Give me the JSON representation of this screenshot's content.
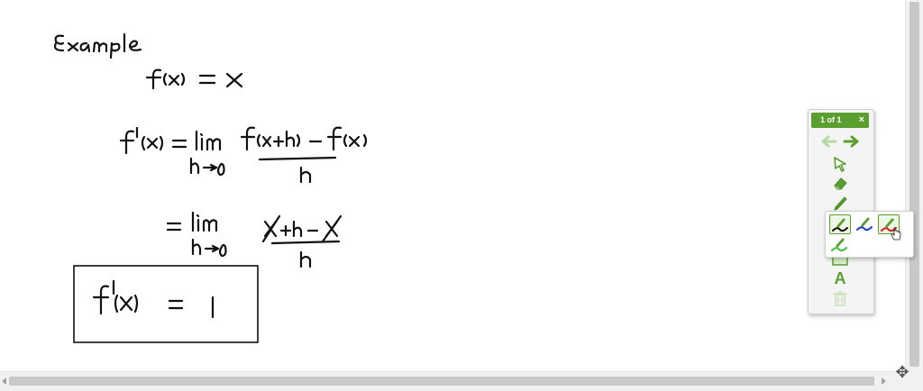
{
  "palette": {
    "page_indicator": "1 of 1",
    "close_glyph": "×",
    "tools": [
      {
        "name": "back-arrow-icon",
        "enabled": false
      },
      {
        "name": "forward-arrow-icon",
        "enabled": true
      },
      {
        "name": "select-pointer-icon",
        "enabled": true
      },
      {
        "name": "eraser-icon",
        "enabled": true
      },
      {
        "name": "pen-icon",
        "enabled": true
      },
      {
        "name": "shapes-icon",
        "enabled": true
      },
      {
        "name": "text-tool-icon",
        "enabled": true
      },
      {
        "name": "trash-icon",
        "enabled": false
      }
    ],
    "text_tool_label": "A"
  },
  "pen_colors": {
    "swatches": [
      "#111111",
      "#1b3fd6",
      "#d11c1c",
      "#39c23a"
    ],
    "selected": "#d11c1c"
  },
  "colors": {
    "accent": "#5a9e2f",
    "ink": "#111111"
  },
  "scroll": {
    "move_handle_glyph": "✥"
  }
}
